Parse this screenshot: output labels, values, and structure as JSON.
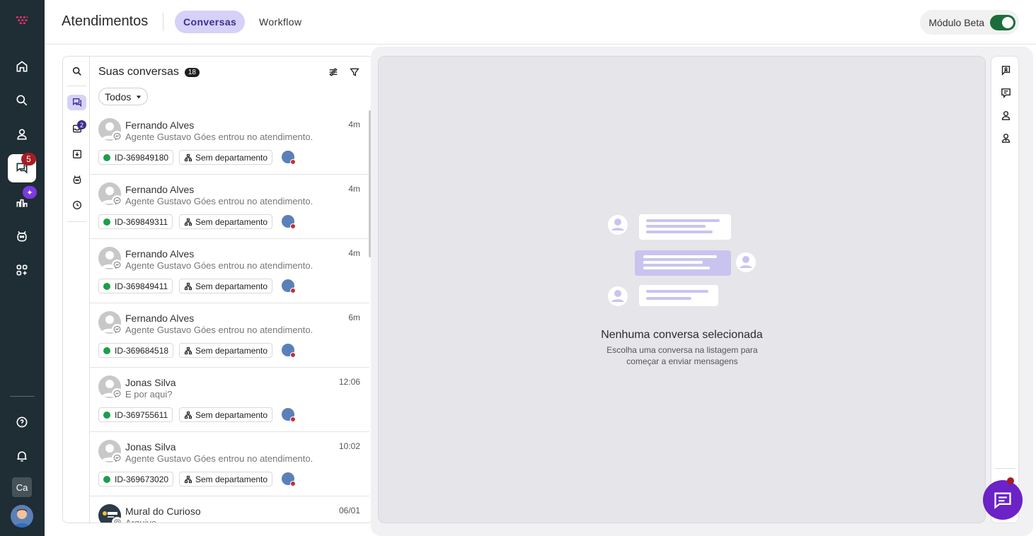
{
  "header": {
    "title": "Atendimentos",
    "tabs": [
      {
        "label": "Conversas"
      },
      {
        "label": "Workflow"
      }
    ],
    "beta_label": "Módulo Beta"
  },
  "leftnav": {
    "conversations_badge": "5",
    "reports_badge": "✦",
    "user_initials": "Ca"
  },
  "iconcol": {
    "inbox_badge": "2"
  },
  "list": {
    "title": "Suas conversas",
    "count": "18",
    "filter_value": "Todos",
    "conversations": [
      {
        "name": "Fernando Alves",
        "time": "4m",
        "message": "Agente Gustavo Góes entrou no atendimento.",
        "id": "ID-369849180",
        "department": "Sem departamento"
      },
      {
        "name": "Fernando Alves",
        "time": "4m",
        "message": "Agente Gustavo Góes entrou no atendimento.",
        "id": "ID-369849311",
        "department": "Sem departamento"
      },
      {
        "name": "Fernando Alves",
        "time": "4m",
        "message": "Agente Gustavo Góes entrou no atendimento.",
        "id": "ID-369849411",
        "department": "Sem departamento"
      },
      {
        "name": "Fernando Alves",
        "time": "6m",
        "message": "Agente Gustavo Góes entrou no atendimento.",
        "id": "ID-369684518",
        "department": "Sem departamento"
      },
      {
        "name": "Jonas Silva",
        "time": "12:06",
        "message": "E por aqui?",
        "id": "ID-369755611",
        "department": "Sem departamento"
      },
      {
        "name": "Jonas Silva",
        "time": "10:02",
        "message": "Agente Gustavo Góes entrou no atendimento.",
        "id": "ID-369673020",
        "department": "Sem departamento"
      },
      {
        "name": "Mural do Curioso",
        "time": "06/01",
        "message": "Arquivo",
        "id": "",
        "department": ""
      }
    ]
  },
  "empty_state": {
    "title": "Nenhuma conversa selecionada",
    "subtitle": "Escolha uma conversa na listagem para começar a enviar mensagens"
  },
  "colors": {
    "accent": "#6b22c7",
    "nav_bg": "#1f2d35",
    "tab_active_bg": "#d6d1f7",
    "online": "#1b9e4b"
  }
}
